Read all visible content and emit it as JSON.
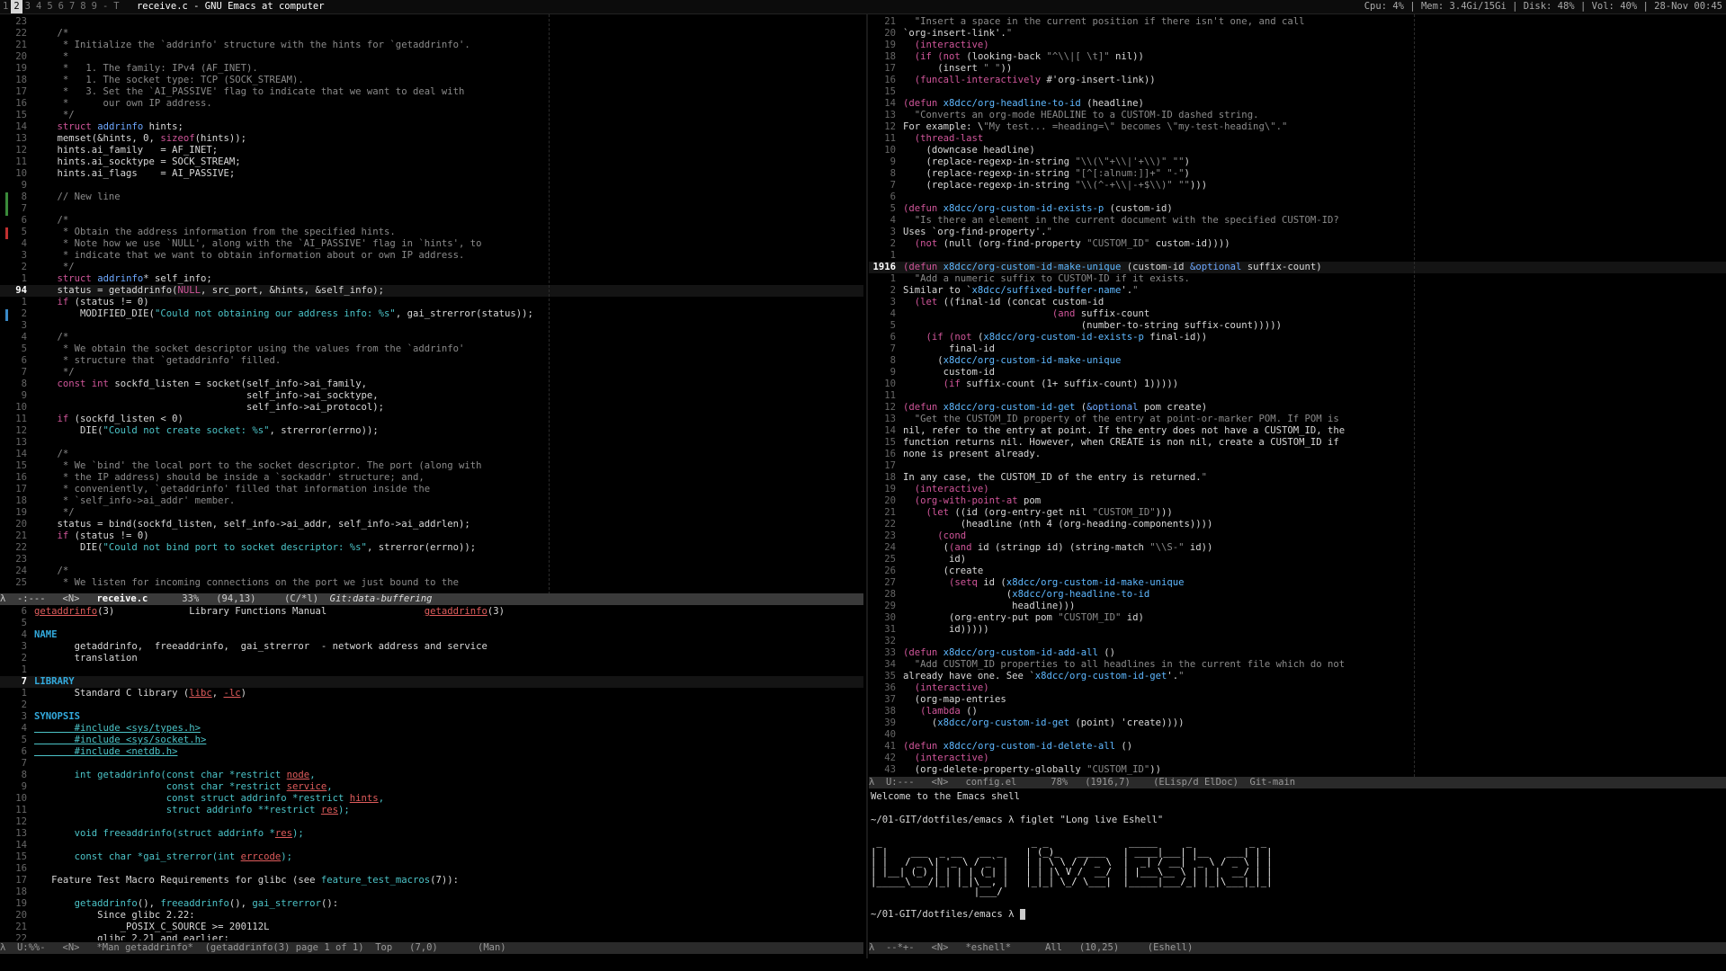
{
  "topbar": {
    "workspaces": [
      "1",
      "2",
      "3",
      "4",
      "5",
      "6",
      "7",
      "8",
      "9",
      "-",
      "T"
    ],
    "active_workspace": "2",
    "window_title": "receive.c - GNU Emacs at computer",
    "stats": "Cpu: 4% | Mem: 3.4Gi/15Gi | Disk: 48% | Vol: 40% | 28-Nov 00:45"
  },
  "colors": {
    "keyword": "#d0569a",
    "type": "#6ea8ff",
    "string": "#4cc4c8",
    "comment": "#8a8a8a",
    "function": "#5fb8ff",
    "constant": "#d0569a",
    "underline_red": "#e05c5c",
    "modeline_bg": "#2a2a2a"
  },
  "left_top": {
    "lines": [
      {
        "n": "23",
        "t": ""
      },
      {
        "n": "22",
        "t": "    /*"
      },
      {
        "n": "21",
        "t": "     * Initialize the `addrinfo' structure with the hints for `getaddrinfo'."
      },
      {
        "n": "20",
        "t": "     *"
      },
      {
        "n": "19",
        "t": "     *   1. The family: IPv4 (AF_INET)."
      },
      {
        "n": "18",
        "t": "     *   1. The socket type: TCP (SOCK_STREAM)."
      },
      {
        "n": "17",
        "t": "     *   3. Set the `AI_PASSIVE' flag to indicate that we want to deal with"
      },
      {
        "n": "16",
        "t": "     *      our own IP address."
      },
      {
        "n": "15",
        "t": "     */"
      },
      {
        "n": "14",
        "t": "    struct addrinfo hints;"
      },
      {
        "n": "13",
        "t": "    memset(&hints, 0, sizeof(hints));"
      },
      {
        "n": "12",
        "t": "    hints.ai_family   = AF_INET;"
      },
      {
        "n": "11",
        "t": "    hints.ai_socktype = SOCK_STREAM;"
      },
      {
        "n": "10",
        "t": "    hints.ai_flags    = AI_PASSIVE;"
      },
      {
        "n": "9",
        "t": ""
      },
      {
        "n": "8",
        "t": "    // New line"
      },
      {
        "n": "7",
        "t": ""
      },
      {
        "n": "6",
        "t": "    /*"
      },
      {
        "n": "5",
        "t": "     * Obtain the address information from the specified hints."
      },
      {
        "n": "4",
        "t": "     * Note how we use `NULL', along with the `AI_PASSIVE' flag in `hints', to"
      },
      {
        "n": "3",
        "t": "     * indicate that we want to obtain information about or own IP address."
      },
      {
        "n": "2",
        "t": "     */"
      },
      {
        "n": "1",
        "t": "    struct addrinfo* self_info;"
      },
      {
        "n": "94",
        "t": "    status = getaddrinfo(NULL, src_port, &hints, &self_info);",
        "cur": true
      },
      {
        "n": "1",
        "t": "    if (status != 0)"
      },
      {
        "n": "2",
        "t": "        MODIFIED_DIE(\"Could not obtaining our address info: %s\", gai_strerror(status));"
      },
      {
        "n": "3",
        "t": ""
      },
      {
        "n": "4",
        "t": "    /*"
      },
      {
        "n": "5",
        "t": "     * We obtain the socket descriptor using the values from the `addrinfo'"
      },
      {
        "n": "6",
        "t": "     * structure that `getaddrinfo' filled."
      },
      {
        "n": "7",
        "t": "     */"
      },
      {
        "n": "8",
        "t": "    const int sockfd_listen = socket(self_info->ai_family,"
      },
      {
        "n": "9",
        "t": "                                     self_info->ai_socktype,"
      },
      {
        "n": "10",
        "t": "                                     self_info->ai_protocol);"
      },
      {
        "n": "11",
        "t": "    if (sockfd_listen < 0)"
      },
      {
        "n": "12",
        "t": "        DIE(\"Could not create socket: %s\", strerror(errno));"
      },
      {
        "n": "13",
        "t": ""
      },
      {
        "n": "14",
        "t": "    /*"
      },
      {
        "n": "15",
        "t": "     * We `bind' the local port to the socket descriptor. The port (along with"
      },
      {
        "n": "16",
        "t": "     * the IP address) should be inside a `sockaddr' structure; and,"
      },
      {
        "n": "17",
        "t": "     * conveniently, `getaddrinfo' filled that information inside the"
      },
      {
        "n": "18",
        "t": "     * `self_info->ai_addr' member."
      },
      {
        "n": "19",
        "t": "     */"
      },
      {
        "n": "20",
        "t": "    status = bind(sockfd_listen, self_info->ai_addr, self_info->ai_addrlen);"
      },
      {
        "n": "21",
        "t": "    if (status != 0)"
      },
      {
        "n": "22",
        "t": "        DIE(\"Could not bind port to socket descriptor: %s\", strerror(errno));"
      },
      {
        "n": "23",
        "t": ""
      },
      {
        "n": "24",
        "t": "    /*"
      },
      {
        "n": "25",
        "t": "     * We listen for incoming connections on the port we just bound to the"
      }
    ],
    "modeline": "λ  -:---   <N>   ",
    "modeline_buffer": "receive.c",
    "modeline_rest": "      33%   (94,13)     (C/*l)  ",
    "modeline_git": "Git:data-buffering"
  },
  "left_bottom": {
    "lines": [
      {
        "n": "6",
        "t": "getaddrinfo(3)             Library Functions Manual                 getaddrinfo(3)"
      },
      {
        "n": "5",
        "t": ""
      },
      {
        "n": "4",
        "t": "NAME"
      },
      {
        "n": "3",
        "t": "       getaddrinfo,  freeaddrinfo,  gai_strerror  - network address and service"
      },
      {
        "n": "2",
        "t": "       translation"
      },
      {
        "n": "1",
        "t": ""
      },
      {
        "n": "7",
        "t": "LIBRARY",
        "cur": true
      },
      {
        "n": "1",
        "t": "       Standard C library (libc, -lc)"
      },
      {
        "n": "2",
        "t": ""
      },
      {
        "n": "3",
        "t": "SYNOPSIS"
      },
      {
        "n": "4",
        "t": "       #include <sys/types.h>"
      },
      {
        "n": "5",
        "t": "       #include <sys/socket.h>"
      },
      {
        "n": "6",
        "t": "       #include <netdb.h>"
      },
      {
        "n": "7",
        "t": ""
      },
      {
        "n": "8",
        "t": "       int getaddrinfo(const char *restrict node,"
      },
      {
        "n": "9",
        "t": "                       const char *restrict service,"
      },
      {
        "n": "10",
        "t": "                       const struct addrinfo *restrict hints,"
      },
      {
        "n": "11",
        "t": "                       struct addrinfo **restrict res);"
      },
      {
        "n": "12",
        "t": ""
      },
      {
        "n": "13",
        "t": "       void freeaddrinfo(struct addrinfo *res);"
      },
      {
        "n": "14",
        "t": ""
      },
      {
        "n": "15",
        "t": "       const char *gai_strerror(int errcode);"
      },
      {
        "n": "16",
        "t": ""
      },
      {
        "n": "17",
        "t": "   Feature Test Macro Requirements for glibc (see feature_test_macros(7)):"
      },
      {
        "n": "18",
        "t": ""
      },
      {
        "n": "19",
        "t": "       getaddrinfo(), freeaddrinfo(), gai_strerror():"
      },
      {
        "n": "20",
        "t": "           Since glibc 2.22:"
      },
      {
        "n": "21",
        "t": "               _POSIX_C_SOURCE >= 200112L"
      },
      {
        "n": "22",
        "t": "           glibc 2.21 and earlier:"
      }
    ],
    "modeline": "λ  U:%%-   <N>   *Man getaddrinfo*  (getaddrinfo(3) page 1 of 1)  Top   (7,0)       (Man)"
  },
  "right_top": {
    "lines": [
      {
        "n": "21",
        "t": "  \"Insert a space in the current position if there isn't one, and call"
      },
      {
        "n": "20",
        "t": "`org-insert-link'.\""
      },
      {
        "n": "19",
        "t": "  (interactive)"
      },
      {
        "n": "18",
        "t": "  (if (not (looking-back \"^\\\\|[ \\t]\" nil))"
      },
      {
        "n": "17",
        "t": "      (insert \" \"))"
      },
      {
        "n": "16",
        "t": "  (funcall-interactively #'org-insert-link))"
      },
      {
        "n": "15",
        "t": ""
      },
      {
        "n": "14",
        "t": "(defun x8dcc/org-headline-to-id (headline)"
      },
      {
        "n": "13",
        "t": "  \"Converts an org-mode HEADLINE to a CUSTOM-ID dashed string."
      },
      {
        "n": "12",
        "t": "For example: \\\"My test... =heading=\\\" becomes \\\"my-test-heading\\\".\""
      },
      {
        "n": "11",
        "t": "  (thread-last"
      },
      {
        "n": "10",
        "t": "    (downcase headline)"
      },
      {
        "n": "9",
        "t": "    (replace-regexp-in-string \"\\\\(\\\"+\\\\|'+\\\\)\" \"\")"
      },
      {
        "n": "8",
        "t": "    (replace-regexp-in-string \"[^[:alnum:]]+\" \"-\")"
      },
      {
        "n": "7",
        "t": "    (replace-regexp-in-string \"\\\\(^-+\\\\|-+$\\\\)\" \"\")))"
      },
      {
        "n": "6",
        "t": ""
      },
      {
        "n": "5",
        "t": "(defun x8dcc/org-custom-id-exists-p (custom-id)"
      },
      {
        "n": "4",
        "t": "  \"Is there an element in the current document with the specified CUSTOM-ID?"
      },
      {
        "n": "3",
        "t": "Uses `org-find-property'.\""
      },
      {
        "n": "2",
        "t": "  (not (null (org-find-property \"CUSTOM_ID\" custom-id))))"
      },
      {
        "n": "1",
        "t": ""
      },
      {
        "n": "1916",
        "t": "(defun x8dcc/org-custom-id-make-unique (custom-id &optional suffix-count)",
        "cur": true
      },
      {
        "n": "1",
        "t": "  \"Add a numeric suffix to CUSTOM-ID if it exists."
      },
      {
        "n": "2",
        "t": "Similar to `x8dcc/suffixed-buffer-name'.\""
      },
      {
        "n": "3",
        "t": "  (let ((final-id (concat custom-id"
      },
      {
        "n": "4",
        "t": "                          (and suffix-count"
      },
      {
        "n": "5",
        "t": "                               (number-to-string suffix-count)))))"
      },
      {
        "n": "6",
        "t": "    (if (not (x8dcc/org-custom-id-exists-p final-id))"
      },
      {
        "n": "7",
        "t": "        final-id"
      },
      {
        "n": "8",
        "t": "      (x8dcc/org-custom-id-make-unique"
      },
      {
        "n": "9",
        "t": "       custom-id"
      },
      {
        "n": "10",
        "t": "       (if suffix-count (1+ suffix-count) 1)))))"
      },
      {
        "n": "11",
        "t": ""
      },
      {
        "n": "12",
        "t": "(defun x8dcc/org-custom-id-get (&optional pom create)"
      },
      {
        "n": "13",
        "t": "  \"Get the CUSTOM_ID property of the entry at point-or-marker POM. If POM is"
      },
      {
        "n": "14",
        "t": "nil, refer to the entry at point. If the entry does not have a CUSTOM_ID, the"
      },
      {
        "n": "15",
        "t": "function returns nil. However, when CREATE is non nil, create a CUSTOM_ID if"
      },
      {
        "n": "16",
        "t": "none is present already."
      },
      {
        "n": "17",
        "t": ""
      },
      {
        "n": "18",
        "t": "In any case, the CUSTOM_ID of the entry is returned.\""
      },
      {
        "n": "19",
        "t": "  (interactive)"
      },
      {
        "n": "20",
        "t": "  (org-with-point-at pom"
      },
      {
        "n": "21",
        "t": "    (let ((id (org-entry-get nil \"CUSTOM_ID\")))"
      },
      {
        "n": "22",
        "t": "          (headline (nth 4 (org-heading-components))))"
      },
      {
        "n": "23",
        "t": "      (cond"
      },
      {
        "n": "24",
        "t": "       ((and id (stringp id) (string-match \"\\\\S-\" id))"
      },
      {
        "n": "25",
        "t": "        id)"
      },
      {
        "n": "26",
        "t": "       (create"
      },
      {
        "n": "27",
        "t": "        (setq id (x8dcc/org-custom-id-make-unique"
      },
      {
        "n": "28",
        "t": "                  (x8dcc/org-headline-to-id"
      },
      {
        "n": "29",
        "t": "                   headline)))"
      },
      {
        "n": "30",
        "t": "        (org-entry-put pom \"CUSTOM_ID\" id)"
      },
      {
        "n": "31",
        "t": "        id)))))"
      },
      {
        "n": "32",
        "t": ""
      },
      {
        "n": "33",
        "t": "(defun x8dcc/org-custom-id-add-all ()"
      },
      {
        "n": "34",
        "t": "  \"Add CUSTOM_ID properties to all headlines in the current file which do not"
      },
      {
        "n": "35",
        "t": "already have one. See `x8dcc/org-custom-id-get'.\""
      },
      {
        "n": "36",
        "t": "  (interactive)"
      },
      {
        "n": "37",
        "t": "  (org-map-entries"
      },
      {
        "n": "38",
        "t": "   (lambda ()"
      },
      {
        "n": "39",
        "t": "     (x8dcc/org-custom-id-get (point) 'create))))"
      },
      {
        "n": "40",
        "t": ""
      },
      {
        "n": "41",
        "t": "(defun x8dcc/org-custom-id-delete-all ()"
      },
      {
        "n": "42",
        "t": "  (interactive)"
      },
      {
        "n": "43",
        "t": "  (org-delete-property-globally \"CUSTOM_ID\"))"
      }
    ],
    "modeline": "λ  U:---   <N>   config.el      78%   (1916,7)    (ELisp/d ElDoc)  Git-main"
  },
  "right_bottom": {
    "welcome": "Welcome to the Emacs shell",
    "prompt1": "~/01-GIT/dotfiles/emacs λ figlet \"Long live Eshell\"",
    "figlet": [
      " _                          _ _              _____     _          _ _ ",
      "| |    ___  _ __   __ _    | (_)_   _____   | ____|___| |__   ___| | |",
      "| |   / _ \\| '_ \\ / _` |   | | \\ \\ / / _ \\  |  _| / __| '_ \\ / _ \\ | |",
      "| |__| (_) | | | | (_| |   | | |\\ V /  __/  | |___\\__ \\ | | |  __/ | |",
      "|_____\\___/|_| |_|\\__, |   |_|_| \\_/ \\___|  |_____|___/_| |_|\\___|_|_|",
      "                  |___/                                                "
    ],
    "prompt2": "~/01-GIT/dotfiles/emacs λ ",
    "modeline": "λ  --*+-   <N>   *eshell*      All   (10,25)     (Eshell)"
  }
}
